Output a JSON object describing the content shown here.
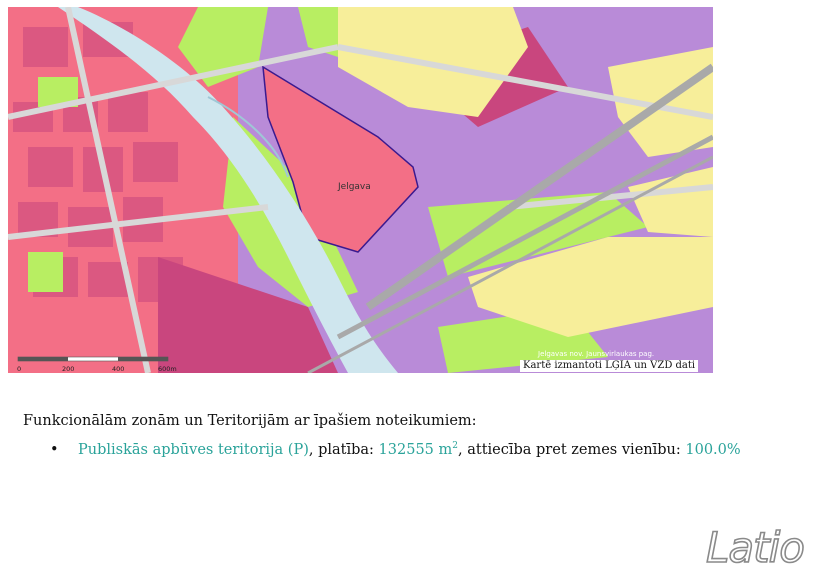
{
  "map": {
    "place_label": "Jelgava",
    "scale_labels": [
      "0",
      "200",
      "400",
      "600m"
    ],
    "source_label": "Jelgavas nov. Jaunsvirlaukas pag.",
    "credit": "Kartē izmantoti LĢIA un VZD dati",
    "colors": {
      "residential": "#f7ee9a",
      "public": "#f36f86",
      "mixed": "#c9467e",
      "industrial": "#b98bd8",
      "green": "#b8ee62",
      "water": "#cfe6ee",
      "roads": "#d8d8d8",
      "rail": "#a9a9a9"
    }
  },
  "heading": "Funkcionālām zonām un Teritorijām ar īpašiem noteikumiem:",
  "items": [
    {
      "zone": "Publiskās apbūves teritorija (P)",
      "area_label": ", platība: ",
      "area_value": "132555 m",
      "area_unit_sup": "2",
      "ratio_label": ", attiecība pret zemes vienību: ",
      "ratio_value": "100.0%"
    }
  ],
  "logo": "Latio",
  "colors": {
    "accent": "#2aa39a",
    "logo_outline": "#8a8a8a"
  }
}
